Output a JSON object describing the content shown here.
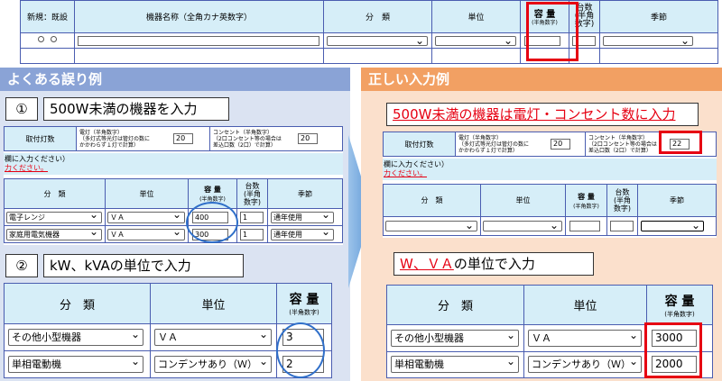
{
  "top_form": {
    "headers": [
      "新規：既設",
      "機器名称（全角カナ英数字）",
      "分　類",
      "単位",
      "容 量",
      "台数",
      "季節"
    ],
    "capacity_note": "(半角数字)",
    "units_note": [
      "(半角",
      "数字)"
    ]
  },
  "wrong": {
    "title": "よくある誤り例",
    "case1": {
      "number": "①",
      "label": "500W未満の機器を入力",
      "toritsuke": "取付灯数",
      "dento_note": [
        "電灯（半角数字）",
        "（多灯式等光灯は管灯の数に",
        "かかわらず１灯で計算）"
      ],
      "dento_value": "20",
      "consent_note": [
        "コンセント（半角数字）",
        "（2口コンセント等の場合は",
        "差込口数（2口）で計算）"
      ],
      "consent_value": "20",
      "notice": "欄に入力ください）",
      "notice_red": "力ください。",
      "headers": [
        "分　類",
        "単位",
        "容 量",
        "台数",
        "季節"
      ],
      "capacity_note": "(半角数字)",
      "units_note": [
        "(半角",
        "数字)"
      ],
      "rows": [
        {
          "category": "電子レンジ",
          "unit": "ＶＡ",
          "capacity": "400",
          "count": "1",
          "season": "通年使用"
        },
        {
          "category": "家庭用電気機器",
          "unit": "ＶＡ",
          "capacity": "300",
          "count": "1",
          "season": "通年使用"
        }
      ]
    },
    "case2": {
      "number": "②",
      "label": "kW、kVAの単位で入力",
      "headers": [
        "分　類",
        "単位",
        "容 量"
      ],
      "capacity_note": "(半角数字)",
      "rows": [
        {
          "category": "その他小型機器",
          "unit": "ＶＡ",
          "capacity": "3"
        },
        {
          "category": "単相電動機",
          "unit": "コンデンサあり（Ｗ）",
          "capacity": "2"
        }
      ]
    }
  },
  "correct": {
    "title": "正しい入力例",
    "case1": {
      "label": "500W未満の機器は電灯・コンセント数に入力",
      "toritsuke": "取付灯数",
      "dento_note": [
        "電灯（半角数字）",
        "（多灯式等光灯は管灯の数に",
        "かかわらず１灯で計算）"
      ],
      "dento_value": "20",
      "consent_note": [
        "コンセント（半角数字）",
        "（2口コンセント等の場合は",
        "差込口数（2口）で計算）"
      ],
      "consent_value": "22",
      "notice": "欄に入力ください）",
      "notice_red": "力ください。",
      "headers": [
        "分　類",
        "単位",
        "容 量",
        "台数",
        "季節"
      ],
      "capacity_note": "(半角数字)",
      "units_note": [
        "(半角",
        "数字)"
      ]
    },
    "case2": {
      "label_underlined": "W、ＶＡ",
      "label_rest": "の単位で入力",
      "headers": [
        "分　類",
        "単位",
        "容 量"
      ],
      "capacity_note": "(半角数字)",
      "rows": [
        {
          "category": "その他小型機器",
          "unit": "ＶＡ",
          "capacity": "3000"
        },
        {
          "category": "単相電動機",
          "unit": "コンデンサあり（Ｗ）",
          "capacity": "2000"
        }
      ]
    }
  },
  "colors": {
    "wrong_banner": "#8aa3d6",
    "correct_banner": "#f2a063",
    "wrong_bg": "#dbe3f2",
    "correct_bg": "#fbe0cc",
    "arrow": "#7fb0e0",
    "highlight_red": "#e60012",
    "ring_blue": "#2f6fc9"
  }
}
